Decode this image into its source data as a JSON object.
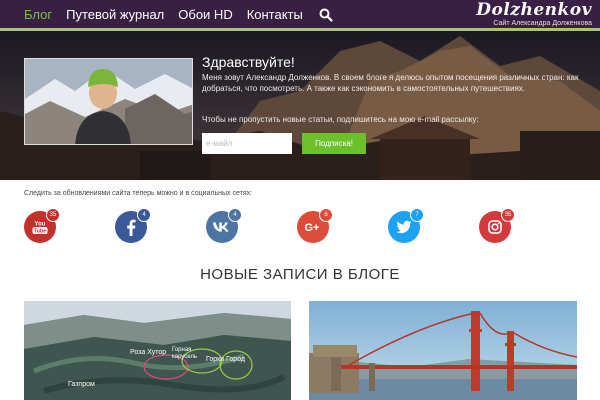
{
  "nav": {
    "items": [
      {
        "label": "Блог"
      },
      {
        "label": "Путевой журнал"
      },
      {
        "label": "Обои HD"
      },
      {
        "label": "Контакты"
      }
    ],
    "search_icon": "search-icon"
  },
  "logo": {
    "name": "Dolzhenkov",
    "tagline": "Сайт Александра Долженкова"
  },
  "hero": {
    "title": "Здравствуйте!",
    "intro": "Меня зовут Александр Долженков. В своем блоге я делюсь опытом посещения различных стран: как добраться, что посмотреть. А также как сэкономить в самостоятельных путешествиях.",
    "cta": "Чтобы не пропустить новые статьи, подпишитесь на мою e-mail рассылку:",
    "email_placeholder": "e-майл",
    "subscribe_label": "Подписка!"
  },
  "social": {
    "label": "Следить за обновлениями сайта теперь можно и в социальных сетях:",
    "networks": [
      {
        "icon": "youtube-icon",
        "count": "35",
        "color": "#c4302b"
      },
      {
        "icon": "facebook-icon",
        "count": "4",
        "color": "#3b5998"
      },
      {
        "icon": "vk-icon",
        "count": "4",
        "color": "#4c75a3"
      },
      {
        "icon": "google-plus-icon",
        "count": "6",
        "color": "#dd4b39"
      },
      {
        "icon": "twitter-icon",
        "count": "7",
        "color": "#1da1f2"
      },
      {
        "icon": "instagram-icon",
        "count": "35",
        "color": "#d6393c"
      }
    ]
  },
  "section": {
    "title": "НОВЫЕ ЗАПИСИ В БЛОГЕ"
  },
  "posts": [
    {
      "map_labels": [
        "Роза Хутор",
        "Горная карусель",
        "Горки Город",
        "Газпром"
      ]
    },
    {}
  ],
  "colors": {
    "nav_bg": "#3a1f45",
    "accent_green": "#6cc02c",
    "nav_active": "#74c044"
  }
}
